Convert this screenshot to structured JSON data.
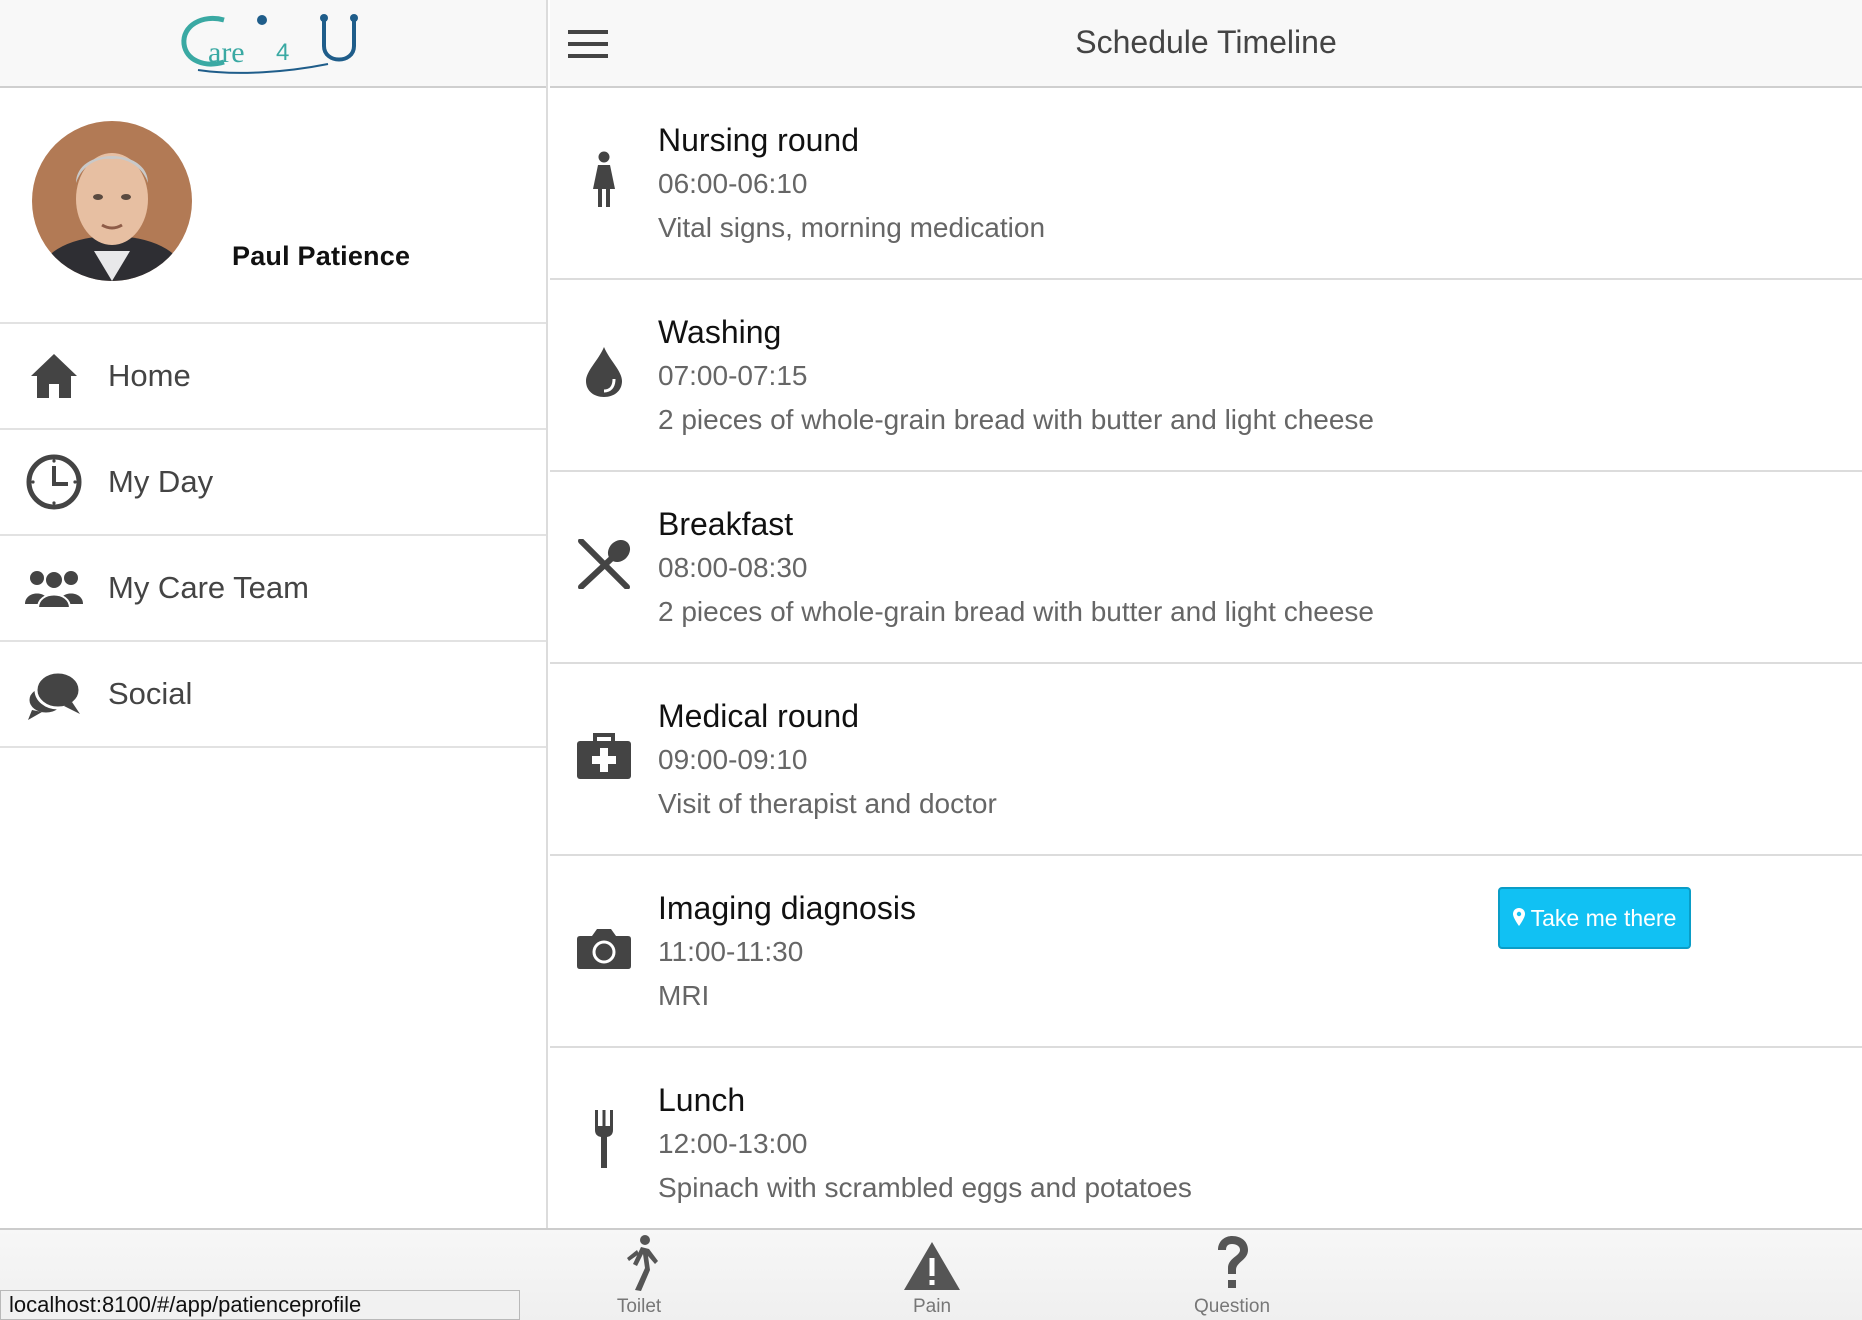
{
  "app": {
    "logo_text": "Care4U"
  },
  "profile": {
    "name": "Paul Patience"
  },
  "nav": {
    "items": [
      {
        "label": "Home",
        "icon": "home-icon"
      },
      {
        "label": "My Day",
        "icon": "clock-icon"
      },
      {
        "label": "My Care Team",
        "icon": "group-icon"
      },
      {
        "label": "Social",
        "icon": "chat-bubbles-icon"
      }
    ]
  },
  "header": {
    "title": "Schedule Timeline"
  },
  "schedule": [
    {
      "title": "Nursing round",
      "time": "06:00-06:10",
      "description": "Vital signs, morning medication",
      "icon": "nurse-icon"
    },
    {
      "title": "Washing",
      "time": "07:00-07:15",
      "description": "2 pieces of whole-grain bread with butter and light cheese",
      "icon": "water-drop-icon"
    },
    {
      "title": "Breakfast",
      "time": "08:00-08:30",
      "description": "2 pieces of whole-grain bread with butter and light cheese",
      "icon": "utensils-icon"
    },
    {
      "title": "Medical round",
      "time": "09:00-09:10",
      "description": "Visit of therapist and doctor",
      "icon": "medkit-icon"
    },
    {
      "title": "Imaging diagnosis",
      "time": "11:00-11:30",
      "description": "MRI",
      "icon": "camera-icon",
      "action_label": "Take me there"
    },
    {
      "title": "Lunch",
      "time": "12:00-13:00",
      "description": "Spinach with scrambled eggs and potatoes",
      "icon": "fork-icon"
    }
  ],
  "tabs": [
    {
      "label": "Toilet",
      "icon": "walking-icon"
    },
    {
      "label": "Pain",
      "icon": "warning-icon"
    },
    {
      "label": "Question",
      "icon": "question-icon"
    }
  ],
  "status_bar": {
    "url": "localhost:8100/#/app/patienceprofile"
  },
  "colors": {
    "accent": "#11c1f3",
    "logo_teal": "#3aa9a3",
    "icon": "#444444"
  }
}
